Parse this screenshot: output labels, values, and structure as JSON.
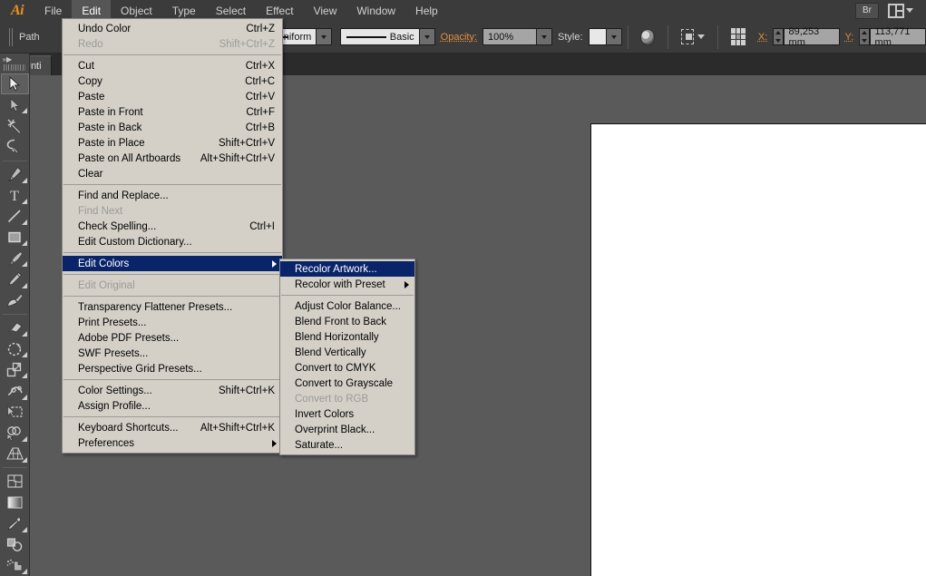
{
  "app": {
    "name": "Adobe Illustrator",
    "logo": "Ai"
  },
  "menubar": {
    "items": [
      {
        "label": "File",
        "active": false
      },
      {
        "label": "Edit",
        "active": true
      },
      {
        "label": "Object",
        "active": false
      },
      {
        "label": "Type",
        "active": false
      },
      {
        "label": "Select",
        "active": false
      },
      {
        "label": "Effect",
        "active": false
      },
      {
        "label": "View",
        "active": false
      },
      {
        "label": "Window",
        "active": false
      },
      {
        "label": "Help",
        "active": false
      }
    ],
    "bridge_button": "Br",
    "arrange_documents_icon": "arrange-documents-icon"
  },
  "controlbar": {
    "object_type": "Path",
    "stroke_profile": "Uniform",
    "brush_definition": "Basic",
    "opacity_label": "Opacity:",
    "opacity_value": "100%",
    "style_label": "Style:",
    "x_label": "X:",
    "x_value": "89,253 mm",
    "y_label": "Y:",
    "y_value": "113,771 mm",
    "recolor_icon": "recolor-artwork-icon",
    "transform_icon": "transform-icon",
    "anchor_grid_icon": "reference-point-icon"
  },
  "tabbar": {
    "documents": [
      {
        "label": "Unti",
        "active": true
      }
    ]
  },
  "toolbar": {
    "tools": [
      {
        "name": "selection-tool",
        "selected": true,
        "flyout": false
      },
      {
        "name": "direct-selection-tool",
        "selected": false,
        "flyout": true
      },
      {
        "name": "magic-wand-tool",
        "selected": false,
        "flyout": false
      },
      {
        "name": "lasso-tool",
        "selected": false,
        "flyout": false
      },
      {
        "name": "pen-tool",
        "selected": false,
        "flyout": true
      },
      {
        "name": "type-tool",
        "selected": false,
        "flyout": true
      },
      {
        "name": "line-segment-tool",
        "selected": false,
        "flyout": true
      },
      {
        "name": "rectangle-tool",
        "selected": false,
        "flyout": true
      },
      {
        "name": "paintbrush-tool",
        "selected": false,
        "flyout": true
      },
      {
        "name": "pencil-tool",
        "selected": false,
        "flyout": true
      },
      {
        "name": "blob-brush-tool",
        "selected": false,
        "flyout": false
      },
      {
        "name": "eraser-tool",
        "selected": false,
        "flyout": true
      },
      {
        "name": "rotate-tool",
        "selected": false,
        "flyout": true
      },
      {
        "name": "scale-tool",
        "selected": false,
        "flyout": true
      },
      {
        "name": "width-tool",
        "selected": false,
        "flyout": true
      },
      {
        "name": "free-transform-tool",
        "selected": false,
        "flyout": false
      },
      {
        "name": "shape-builder-tool",
        "selected": false,
        "flyout": true
      },
      {
        "name": "perspective-grid-tool",
        "selected": false,
        "flyout": true
      },
      {
        "name": "mesh-tool",
        "selected": false,
        "flyout": false
      },
      {
        "name": "gradient-tool",
        "selected": false,
        "flyout": false
      },
      {
        "name": "eyedropper-tool",
        "selected": false,
        "flyout": true
      },
      {
        "name": "blend-tool",
        "selected": false,
        "flyout": false
      },
      {
        "name": "symbol-sprayer-tool",
        "selected": false,
        "flyout": true
      }
    ]
  },
  "edit_menu": {
    "groups": [
      [
        {
          "label": "Undo Color",
          "shortcut": "Ctrl+Z",
          "disabled": false,
          "highlighted": false,
          "submenu": false
        },
        {
          "label": "Redo",
          "shortcut": "Shift+Ctrl+Z",
          "disabled": true,
          "highlighted": false,
          "submenu": false
        }
      ],
      [
        {
          "label": "Cut",
          "shortcut": "Ctrl+X",
          "disabled": false,
          "highlighted": false,
          "submenu": false
        },
        {
          "label": "Copy",
          "shortcut": "Ctrl+C",
          "disabled": false,
          "highlighted": false,
          "submenu": false
        },
        {
          "label": "Paste",
          "shortcut": "Ctrl+V",
          "disabled": false,
          "highlighted": false,
          "submenu": false
        },
        {
          "label": "Paste in Front",
          "shortcut": "Ctrl+F",
          "disabled": false,
          "highlighted": false,
          "submenu": false
        },
        {
          "label": "Paste in Back",
          "shortcut": "Ctrl+B",
          "disabled": false,
          "highlighted": false,
          "submenu": false
        },
        {
          "label": "Paste in Place",
          "shortcut": "Shift+Ctrl+V",
          "disabled": false,
          "highlighted": false,
          "submenu": false
        },
        {
          "label": "Paste on All Artboards",
          "shortcut": "Alt+Shift+Ctrl+V",
          "disabled": false,
          "highlighted": false,
          "submenu": false
        },
        {
          "label": "Clear",
          "shortcut": "",
          "disabled": false,
          "highlighted": false,
          "submenu": false
        }
      ],
      [
        {
          "label": "Find and Replace...",
          "shortcut": "",
          "disabled": false,
          "highlighted": false,
          "submenu": false
        },
        {
          "label": "Find Next",
          "shortcut": "",
          "disabled": true,
          "highlighted": false,
          "submenu": false
        },
        {
          "label": "Check Spelling...",
          "shortcut": "Ctrl+I",
          "disabled": false,
          "highlighted": false,
          "submenu": false
        },
        {
          "label": "Edit Custom Dictionary...",
          "shortcut": "",
          "disabled": false,
          "highlighted": false,
          "submenu": false
        }
      ],
      [
        {
          "label": "Edit Colors",
          "shortcut": "",
          "disabled": false,
          "highlighted": true,
          "submenu": true
        }
      ],
      [
        {
          "label": "Edit Original",
          "shortcut": "",
          "disabled": true,
          "highlighted": false,
          "submenu": false
        }
      ],
      [
        {
          "label": "Transparency Flattener Presets...",
          "shortcut": "",
          "disabled": false,
          "highlighted": false,
          "submenu": false
        },
        {
          "label": "Print Presets...",
          "shortcut": "",
          "disabled": false,
          "highlighted": false,
          "submenu": false
        },
        {
          "label": "Adobe PDF Presets...",
          "shortcut": "",
          "disabled": false,
          "highlighted": false,
          "submenu": false
        },
        {
          "label": "SWF Presets...",
          "shortcut": "",
          "disabled": false,
          "highlighted": false,
          "submenu": false
        },
        {
          "label": "Perspective Grid Presets...",
          "shortcut": "",
          "disabled": false,
          "highlighted": false,
          "submenu": false
        }
      ],
      [
        {
          "label": "Color Settings...",
          "shortcut": "Shift+Ctrl+K",
          "disabled": false,
          "highlighted": false,
          "submenu": false
        },
        {
          "label": "Assign Profile...",
          "shortcut": "",
          "disabled": false,
          "highlighted": false,
          "submenu": false
        }
      ],
      [
        {
          "label": "Keyboard Shortcuts...",
          "shortcut": "Alt+Shift+Ctrl+K",
          "disabled": false,
          "highlighted": false,
          "submenu": false
        },
        {
          "label": "Preferences",
          "shortcut": "",
          "disabled": false,
          "highlighted": false,
          "submenu": true
        }
      ]
    ]
  },
  "edit_colors_submenu": {
    "groups": [
      [
        {
          "label": "Recolor Artwork...",
          "shortcut": "",
          "disabled": false,
          "highlighted": true,
          "submenu": false
        },
        {
          "label": "Recolor with Preset",
          "shortcut": "",
          "disabled": false,
          "highlighted": false,
          "submenu": true
        }
      ],
      [
        {
          "label": "Adjust Color Balance...",
          "shortcut": "",
          "disabled": false,
          "highlighted": false,
          "submenu": false
        },
        {
          "label": "Blend Front to Back",
          "shortcut": "",
          "disabled": false,
          "highlighted": false,
          "submenu": false
        },
        {
          "label": "Blend Horizontally",
          "shortcut": "",
          "disabled": false,
          "highlighted": false,
          "submenu": false
        },
        {
          "label": "Blend Vertically",
          "shortcut": "",
          "disabled": false,
          "highlighted": false,
          "submenu": false
        },
        {
          "label": "Convert to CMYK",
          "shortcut": "",
          "disabled": false,
          "highlighted": false,
          "submenu": false
        },
        {
          "label": "Convert to Grayscale",
          "shortcut": "",
          "disabled": false,
          "highlighted": false,
          "submenu": false
        },
        {
          "label": "Convert to RGB",
          "shortcut": "",
          "disabled": true,
          "highlighted": false,
          "submenu": false
        },
        {
          "label": "Invert Colors",
          "shortcut": "",
          "disabled": false,
          "highlighted": false,
          "submenu": false
        },
        {
          "label": "Overprint Black...",
          "shortcut": "",
          "disabled": false,
          "highlighted": false,
          "submenu": false
        },
        {
          "label": "Saturate...",
          "shortcut": "",
          "disabled": false,
          "highlighted": false,
          "submenu": false
        }
      ]
    ]
  },
  "canvas": {
    "artboard_background": "#ffffff",
    "selected_shape": {
      "name": "green-rectangle",
      "fill": "#6cc070",
      "selection_color": "#5b8fe0"
    }
  },
  "colors": {
    "chrome_dark": "#3b3b3b",
    "canvas_gray": "#5a5a5a",
    "menu_bg": "#d4d0c8",
    "menu_highlight": "#0a246a",
    "accent_orange": "#e09040"
  }
}
